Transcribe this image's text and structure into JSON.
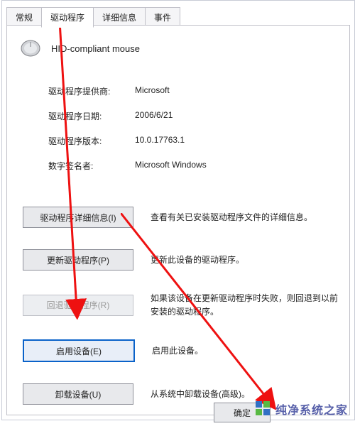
{
  "tabs": {
    "general": "常规",
    "driver": "驱动程序",
    "details": "详细信息",
    "events": "事件"
  },
  "header": {
    "device_name": "HID-compliant mouse"
  },
  "info": {
    "provider_label": "驱动程序提供商:",
    "provider_value": "Microsoft",
    "date_label": "驱动程序日期:",
    "date_value": "2006/6/21",
    "version_label": "驱动程序版本:",
    "version_value": "10.0.17763.1",
    "signer_label": "数字签名者:",
    "signer_value": "Microsoft Windows"
  },
  "buttons": {
    "details": "驱动程序详细信息(I)",
    "details_desc": "查看有关已安装驱动程序文件的详细信息。",
    "update": "更新驱动程序(P)",
    "update_desc": "更新此设备的驱动程序。",
    "rollback": "回退驱动程序(R)",
    "rollback_desc": "如果该设备在更新驱动程序时失败，则回退到以前安装的驱动程序。",
    "enable": "启用设备(E)",
    "enable_desc": "启用此设备。",
    "uninstall": "卸载设备(U)",
    "uninstall_desc": "从系统中卸载设备(高级)。"
  },
  "footer": {
    "ok": "确定"
  },
  "watermark": {
    "text": "纯净系统之家"
  }
}
